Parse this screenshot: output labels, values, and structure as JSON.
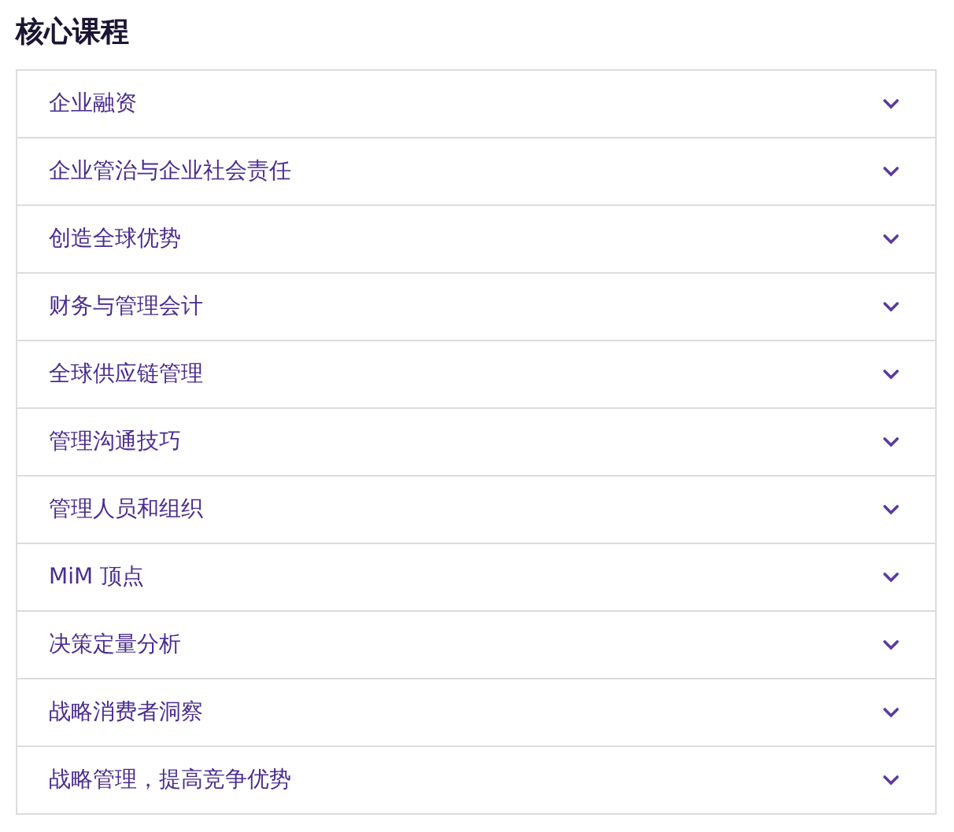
{
  "title": "核心课程",
  "courses": [
    {
      "label": "企业融资",
      "expanded": false
    },
    {
      "label": "企业管治与企业社会责任",
      "expanded": false
    },
    {
      "label": "创造全球优势",
      "expanded": false
    },
    {
      "label": "财务与管理会计",
      "expanded": false
    },
    {
      "label": "全球供应链管理",
      "expanded": false
    },
    {
      "label": "管理沟通技巧",
      "expanded": false
    },
    {
      "label": "管理人员和组织",
      "expanded": false
    },
    {
      "label": "MiM 顶点",
      "expanded": false
    },
    {
      "label": "决策定量分析",
      "expanded": false
    },
    {
      "label": "战略消费者洞察",
      "expanded": false
    },
    {
      "label": "战略管理，提高竞争优势",
      "expanded": false
    }
  ]
}
